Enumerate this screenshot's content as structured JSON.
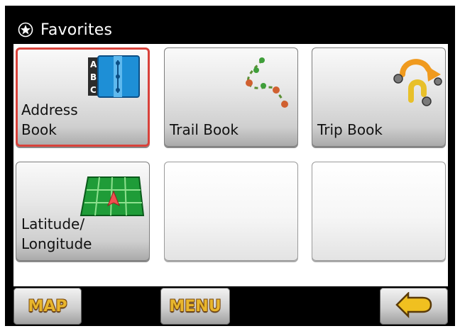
{
  "window": {
    "title": "Favorites",
    "title_icon": "favorites-star-icon"
  },
  "tiles": [
    {
      "label": "Address\nBook",
      "icon": "address-book-icon",
      "selected": true
    },
    {
      "label": "Trail Book",
      "icon": "trail-book-icon",
      "selected": false
    },
    {
      "label": "Trip Book",
      "icon": "trip-book-icon",
      "selected": false
    },
    {
      "label": "Latitude/\nLongitude",
      "icon": "lat-long-grid-icon",
      "selected": false
    },
    {
      "label": "",
      "icon": "",
      "selected": false
    },
    {
      "label": "",
      "icon": "",
      "selected": false
    }
  ],
  "bottom": {
    "map_label": "MAP",
    "menu_label": "MENU",
    "back_icon": "back-arrow-icon"
  },
  "colors": {
    "selection": "#d8413a",
    "button_text": "#e8b62c",
    "bar": "#000000"
  }
}
